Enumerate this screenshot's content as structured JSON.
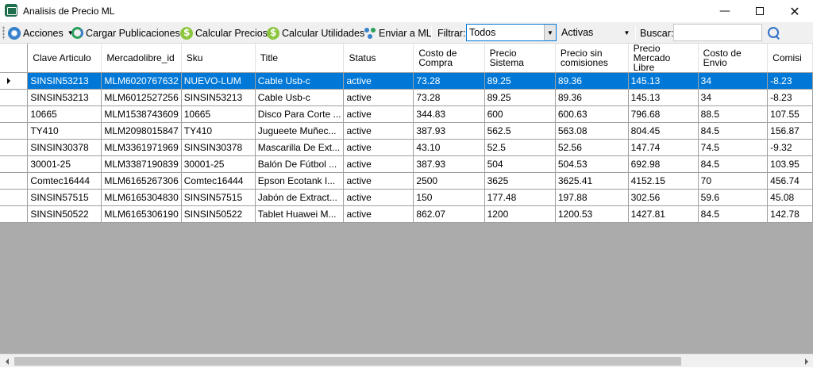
{
  "window": {
    "title": "Analisis de Precio ML",
    "minimize": "—",
    "close": "✕"
  },
  "toolbar": {
    "acciones": "Acciones",
    "cargar": "Cargar Publicaciones",
    "calcular_precios": "Calcular Precios",
    "calcular_utilidades": "Calcular Utilidades",
    "enviar": "Enviar a ML",
    "filtrar_label": "Filtrar:",
    "filtrar_value": "Todos",
    "estado_value": "Activas",
    "buscar_label": "Buscar:",
    "buscar_value": ""
  },
  "grid": {
    "columns": [
      "Clave Articulo",
      "Mercadolibre_id",
      "Sku",
      "Title",
      "Status",
      "Costo de Compra",
      "Precio Sistema",
      "Precio sin comisiones",
      "Precio Mercado Libre",
      "Costo de Envio",
      "Comisi"
    ],
    "selected_row": 0,
    "rows": [
      [
        "SINSIN53213",
        "MLM6020767632",
        "NUEVO-LUM",
        "Cable Usb-c",
        "active",
        "73.28",
        "89.25",
        "89.36",
        "145.13",
        "34",
        "-8.23"
      ],
      [
        "SINSIN53213",
        "MLM6012527256",
        "SINSIN53213",
        "Cable Usb-c",
        "active",
        "73.28",
        "89.25",
        "89.36",
        "145.13",
        "34",
        "-8.23"
      ],
      [
        "10665",
        "MLM1538743609",
        "10665",
        "Disco Para Corte ...",
        "active",
        "344.83",
        "600",
        "600.63",
        "796.68",
        "88.5",
        "107.55"
      ],
      [
        "TY410",
        "MLM2098015847",
        "TY410",
        "Jugueete Muñec...",
        "active",
        "387.93",
        "562.5",
        "563.08",
        "804.45",
        "84.5",
        "156.87"
      ],
      [
        "SINSIN30378",
        "MLM3361971969",
        "SINSIN30378",
        "Mascarilla De Ext...",
        "active",
        "43.10",
        "52.5",
        "52.56",
        "147.74",
        "74.5",
        "-9.32"
      ],
      [
        "30001-25",
        "MLM3387190839",
        "30001-25",
        "Balón De Fútbol ...",
        "active",
        "387.93",
        "504",
        "504.53",
        "692.98",
        "84.5",
        "103.95"
      ],
      [
        "Comtec16444",
        "MLM6165267306",
        "Comtec16444",
        "Epson Ecotank I...",
        "active",
        "2500",
        "3625",
        "3625.41",
        "4152.15",
        "70",
        "456.74"
      ],
      [
        "SINSIN57515",
        "MLM6165304830",
        "SINSIN57515",
        "Jabón de Extract...",
        "active",
        "150",
        "177.48",
        "197.88",
        "302.56",
        "59.6",
        "45.08"
      ],
      [
        "SINSIN50522",
        "MLM6165306190",
        "SINSIN50522",
        "Tablet Huawei M...",
        "active",
        "862.07",
        "1200",
        "1200.53",
        "1427.81",
        "84.5",
        "142.78"
      ]
    ]
  },
  "colors": {
    "selection": "#0078d7",
    "empty_area": "#ababab",
    "toolbar_bg": "#f0f0f0"
  }
}
